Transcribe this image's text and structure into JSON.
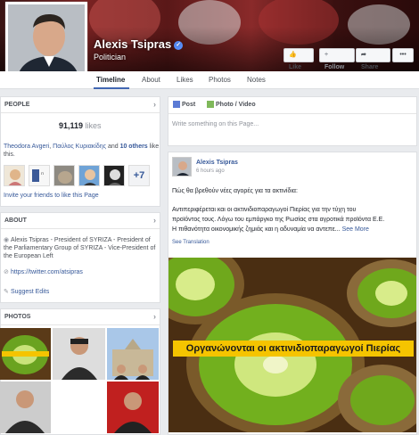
{
  "page": {
    "name": "Alexis Tsipras",
    "verified_mark": "✓",
    "category": "Politician"
  },
  "cover_buttons": {
    "like": "Like",
    "follow": "Follow",
    "share": "Share",
    "more": "•••"
  },
  "nav_tabs": [
    "Timeline",
    "About",
    "Likes",
    "Photos",
    "Notes"
  ],
  "people": {
    "title": "PEOPLE",
    "likes_count": "91,119",
    "likes_word": "likes",
    "friend1": "Theodora Avgeri",
    "friend2": "Παύλος Κυριακίδης",
    "friends_and": "and",
    "others": "10 others",
    "friends_suffix": "like this.",
    "more_badge": "+7",
    "invite": "Invite your friends to like this Page"
  },
  "about": {
    "title": "ABOUT",
    "bio": "Alexis Tsipras - President of SYRIZA - President of the Parliamentary Group of SYRIZA - Vice-President of the European Left",
    "twitter": "https://twitter.com/atsipras",
    "suggest": "Suggest Edits"
  },
  "photos": {
    "title": "PHOTOS"
  },
  "composer": {
    "post_tab": "Post",
    "photo_tab": "Photo / Video",
    "placeholder": "Write something on this Page..."
  },
  "post": {
    "author": "Alexis Tsipras",
    "time": "6 hours ago",
    "line1": "Πώς θα βρεθούν νέες αγορές για τα ακτινίδια:",
    "line2": "Αντιπεριφέρεται και οι ακτινιδιοπαραγωγοί Πιερίας για την τύχη του",
    "line3": "προϊόντος τους. Λόγω του εμπάργκο της Ρωσίας στα αγροτικά προϊόντα Ε.Ε.",
    "line4": "Η πιθανότητα οικονομικής ζημιάς και η αδυναμία να αντεπε...",
    "see_more": "See More",
    "see_translation": "See Translation",
    "image_caption": "Οργανώνονται οι ακτινιδιοπαραγωγοί Πιερίας"
  },
  "icons": [
    "chevron-right-icon",
    "globe-icon",
    "link-icon",
    "edit-icon",
    "post-icon",
    "photo-icon",
    "verified-icon"
  ],
  "colors": {
    "facebook_blue": "#4267b2",
    "link": "#365899",
    "banner_yellow": "#f5c400",
    "background": "#e9ebee"
  }
}
